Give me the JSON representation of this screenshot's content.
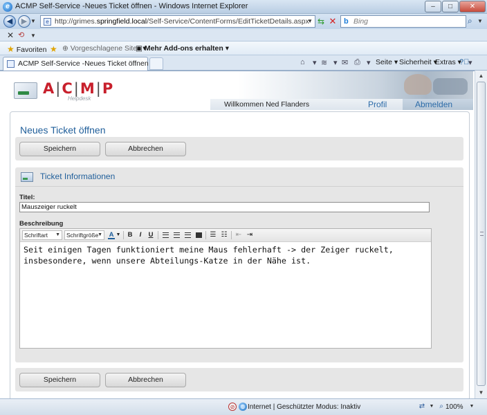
{
  "browser": {
    "window_title": "ACMP Self-Service -Neues Ticket öffnen - Windows Internet Explorer",
    "address_host_prefix": "http://grimes.",
    "address_host_bold": "springfield.local",
    "address_path": "/Self-Service/ContentForms/EditTicketDetails.aspx",
    "search_placeholder": "Bing",
    "favorites_label": "Favoriten",
    "suggested_sites_label": "Vorgeschlagene Sites",
    "addons_label": "Mehr Add-ons erhalten",
    "tab_label": "ACMP Self-Service -Neues Ticket öffnen",
    "tools": {
      "page_label": "Seite",
      "safety_label": "Sicherheit",
      "extras_label": "Extras"
    },
    "status": {
      "zone_text": "Internet | Geschützter Modus: Inaktiv",
      "zoom_text": "100%"
    }
  },
  "app": {
    "logo_text_a": "A",
    "logo_text_c": "C",
    "logo_text_m": "M",
    "logo_text_p": "P",
    "logo_sep": "|",
    "logo_subtitle": "Helpdesk",
    "welcome_text": "Willkommen Ned Flanders",
    "profile_link": "Profil",
    "logout_link": "Abmelden",
    "page_title": "Neues Ticket öffnen",
    "save_label": "Speichern",
    "cancel_label": "Abbrechen",
    "section_title": "Ticket Informationen",
    "title_label": "Titel:",
    "title_value": "Mauszeiger ruckelt",
    "description_label": "Beschreibung",
    "editor": {
      "font_select": "Schriftart",
      "size_select": "Schriftgröße",
      "font_color_glyph": "A",
      "bold_glyph": "B",
      "italic_glyph": "I",
      "underline_glyph": "U",
      "content": "Seit einigen Tagen funktioniert meine Maus fehlerhaft -> der Zeiger ruckelt, insbesondere, wenn unsere Abteilungs-Katze in der Nähe ist."
    }
  },
  "colors": {
    "accent_blue": "#1f5e9a",
    "logo_red": "#c8202c",
    "panel_gray": "#e6e6e6"
  },
  "icons": [
    "back-icon",
    "forward-icon",
    "refresh-icon",
    "stop-icon",
    "search-icon",
    "favorites-star-icon",
    "home-icon",
    "feeds-icon",
    "mail-icon",
    "print-icon",
    "help-icon",
    "ticket-info-icon",
    "globe-icon"
  ]
}
